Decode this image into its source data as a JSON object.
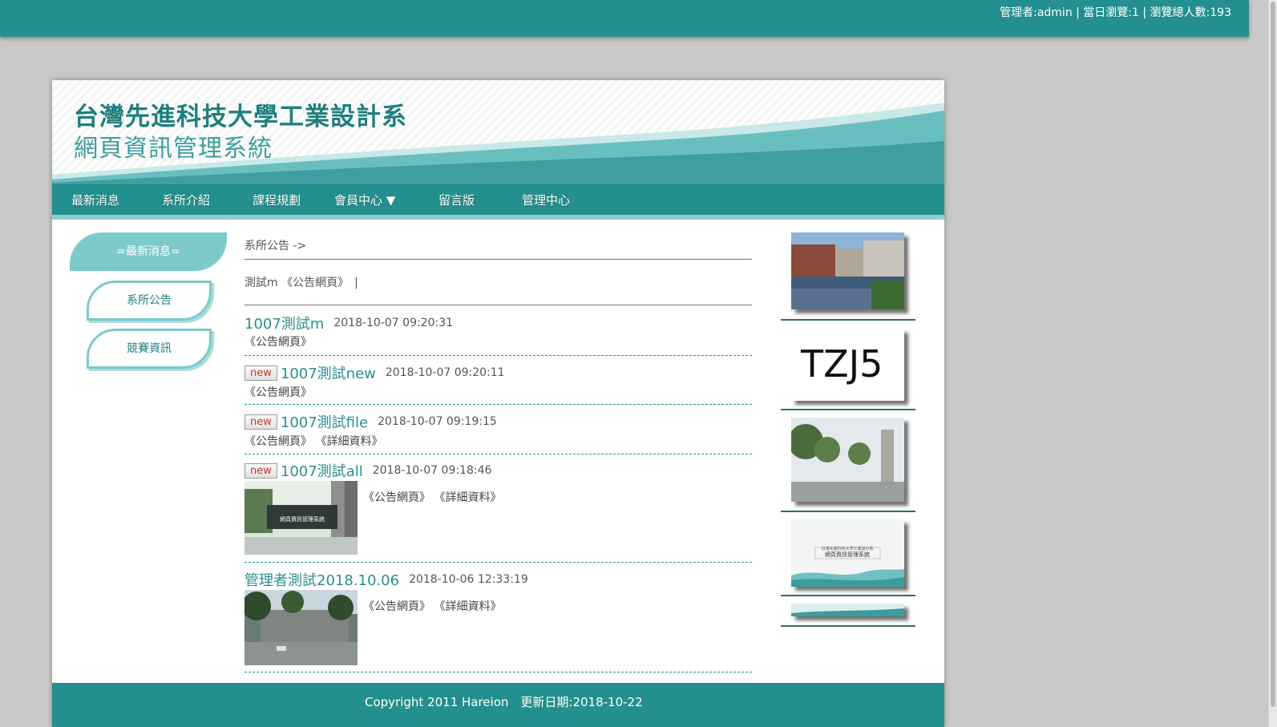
{
  "topbar": {
    "stats": "管理者:admin | 當日瀏覽:1 | 瀏覽總人數:193"
  },
  "banner": {
    "title": "台灣先進科技大學工業設計系",
    "subtitle": "網頁資訊管理系統"
  },
  "nav": {
    "items": [
      "最新消息",
      "系所介紹",
      "課程規劃",
      "會員中心 ▼",
      "留言版",
      "管理中心"
    ]
  },
  "sidebar": {
    "header": "=最新消息=",
    "items": [
      "系所公告",
      "競賽資訊"
    ]
  },
  "main": {
    "breadcrumb": "系所公告 ->",
    "tagline": "測試m 《公告網頁》　|",
    "news": [
      {
        "badge": "",
        "title": "1007測試m",
        "date": "2018-10-07 09:20:31",
        "links": [
          "《公告網頁》"
        ]
      },
      {
        "badge": "new",
        "title": "1007測試new",
        "date": "2018-10-07 09:20:11",
        "links": [
          "《公告網頁》"
        ]
      },
      {
        "badge": "new",
        "title": "1007測試file",
        "date": "2018-10-07 09:19:15",
        "links": [
          "《公告網頁》",
          "《詳細資料》"
        ]
      },
      {
        "badge": "new",
        "title": "1007測試all",
        "date": "2018-10-07 09:18:46",
        "links": [
          "《公告網頁》",
          "《詳細資料》"
        ],
        "thumbnail_text": "網頁資訊管理系統"
      },
      {
        "badge": "",
        "title": "管理者測試2018.10.06",
        "date": "2018-10-06 12:33:19",
        "links": [
          "《公告網頁》",
          "《詳細資料》"
        ]
      }
    ]
  },
  "right_column": {
    "captcha": "TZJ5",
    "banner_thumb_title": "台灣先進科技大學工業設計系",
    "banner_thumb_subtitle": "網頁資訊管理系統"
  },
  "footer": {
    "text": "Copyright 2011 Hareion　更新日期:2018-10-22"
  },
  "colors": {
    "accent": "#238f8e",
    "accent_light": "#7dcaca"
  }
}
